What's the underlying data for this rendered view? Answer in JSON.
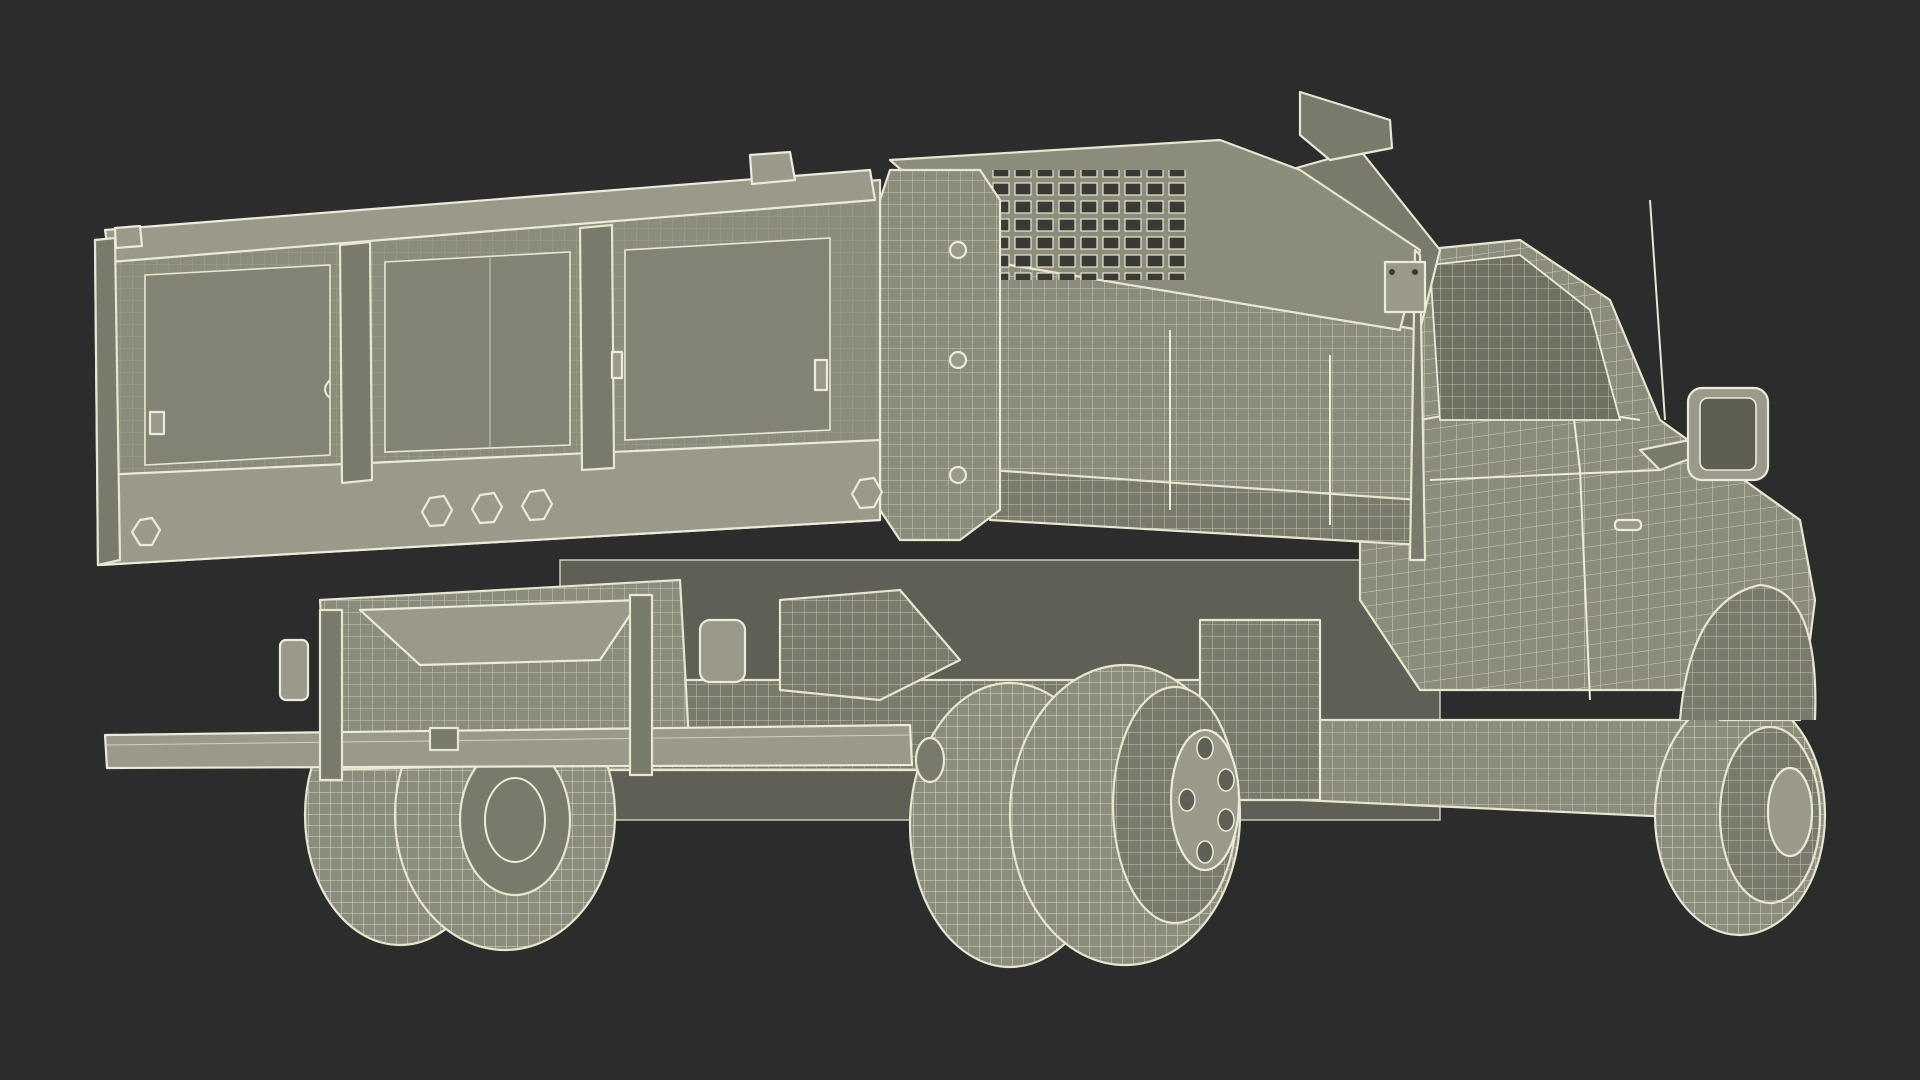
{
  "scene": {
    "subject": "dump-truck",
    "render_style": "wireframe",
    "colors": {
      "background": "#2c2c2c",
      "body_fill": "#8c8c7d",
      "body_fill_dark": "#7a7a6c",
      "wire": "#e9e6cf"
    }
  }
}
